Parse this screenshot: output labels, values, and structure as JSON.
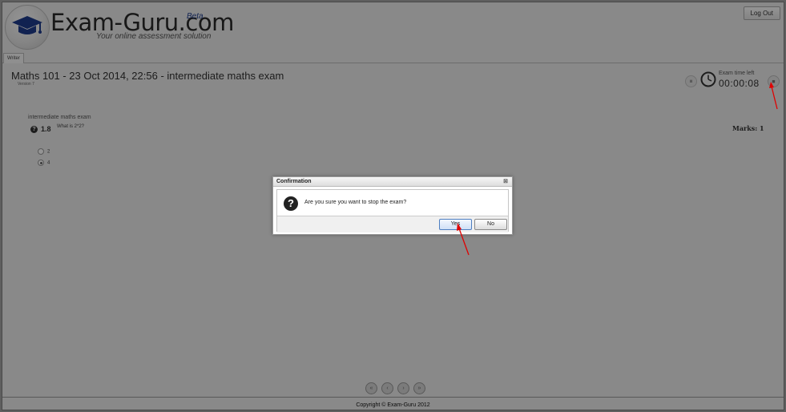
{
  "header": {
    "brand": "Exam-Guru.com",
    "beta": "Beta",
    "tagline": "Your online assessment solution",
    "logout_label": "Log Out"
  },
  "tabs": [
    {
      "label": "Writer"
    }
  ],
  "exam": {
    "title": "Maths 101  - 23 Oct 2014, 22:56 - intermediate maths exam",
    "version": "Version 7",
    "time_left_label": "Exam time left",
    "time_left": "00:00:08",
    "section_label": "intermediate maths exam",
    "question_number": "1.8",
    "question_text": "What is 2*2?",
    "marks": "Marks: 1",
    "options": [
      {
        "label": "2",
        "selected": false
      },
      {
        "label": "4",
        "selected": true
      }
    ]
  },
  "dialog": {
    "title": "Confirmation",
    "message": "Are you sure you want to stop the exam?",
    "yes_label": "Yes",
    "no_label": "No"
  },
  "footer": {
    "copyright": "Copyright © Exam-Guru 2012"
  },
  "icons": {
    "logo": "graduation-cap-icon",
    "clock": "clock-icon",
    "stop": "stop-icon",
    "question": "question-icon"
  },
  "colors": {
    "overlay": "#5f5f5f",
    "brand_blue": "#1e3c8c",
    "annotation_arrow": "#e00000"
  }
}
